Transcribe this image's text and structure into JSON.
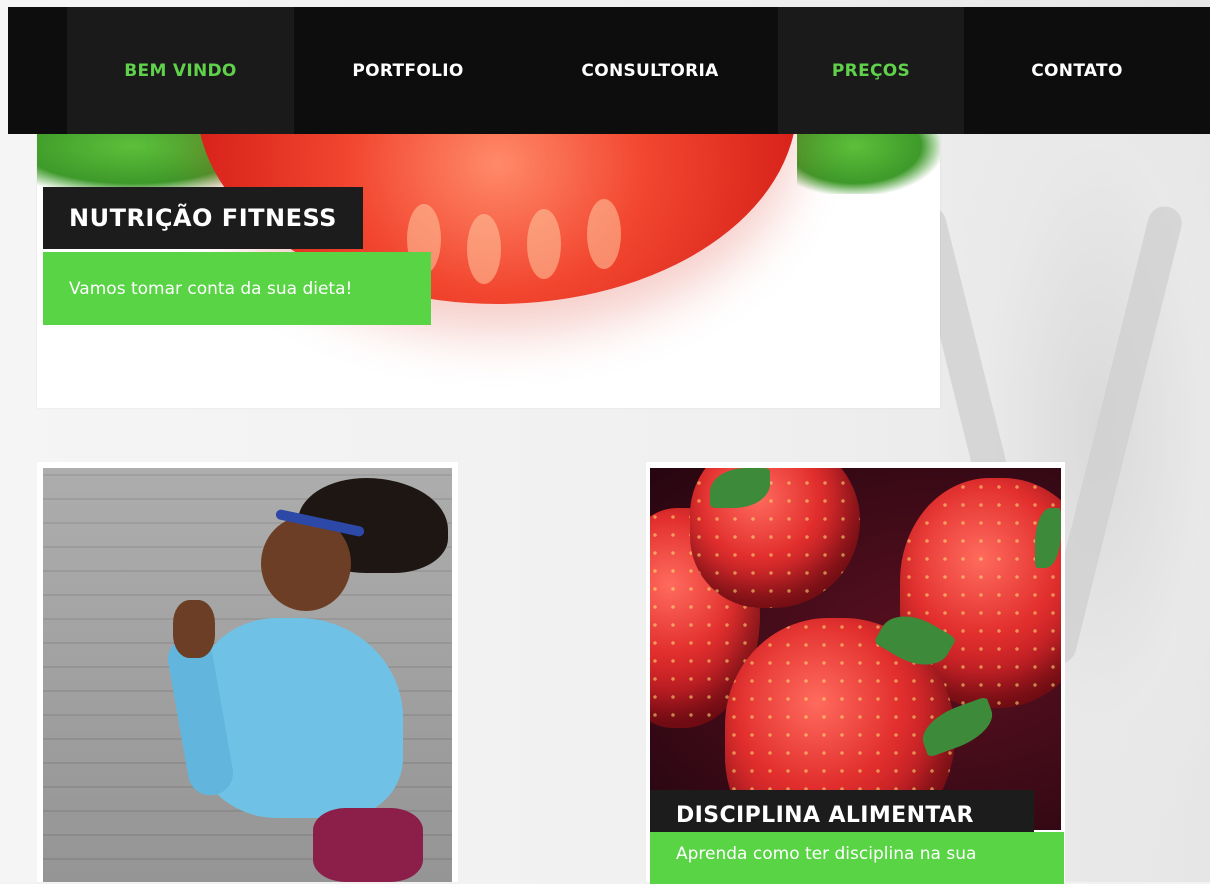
{
  "nav": {
    "items": [
      {
        "label": "BEM VINDO",
        "active": true
      },
      {
        "label": "PORTFOLIO",
        "active": false
      },
      {
        "label": "CONSULTORIA",
        "active": false
      },
      {
        "label": "PREÇOS",
        "active": true
      },
      {
        "label": "CONTATO",
        "active": false
      }
    ]
  },
  "hero": {
    "title": "NUTRIÇÃO FITNESS",
    "subtitle": "Vamos tomar conta da sua dieta!"
  },
  "cards": {
    "runner": {},
    "discipline": {
      "title": "DISCIPLINA ALIMENTAR",
      "subtitle": "Aprenda como ter disciplina na sua"
    }
  },
  "colors": {
    "accent_green": "#58d445",
    "nav_background": "#0d0d0d",
    "label_background": "#1c1c1c"
  }
}
